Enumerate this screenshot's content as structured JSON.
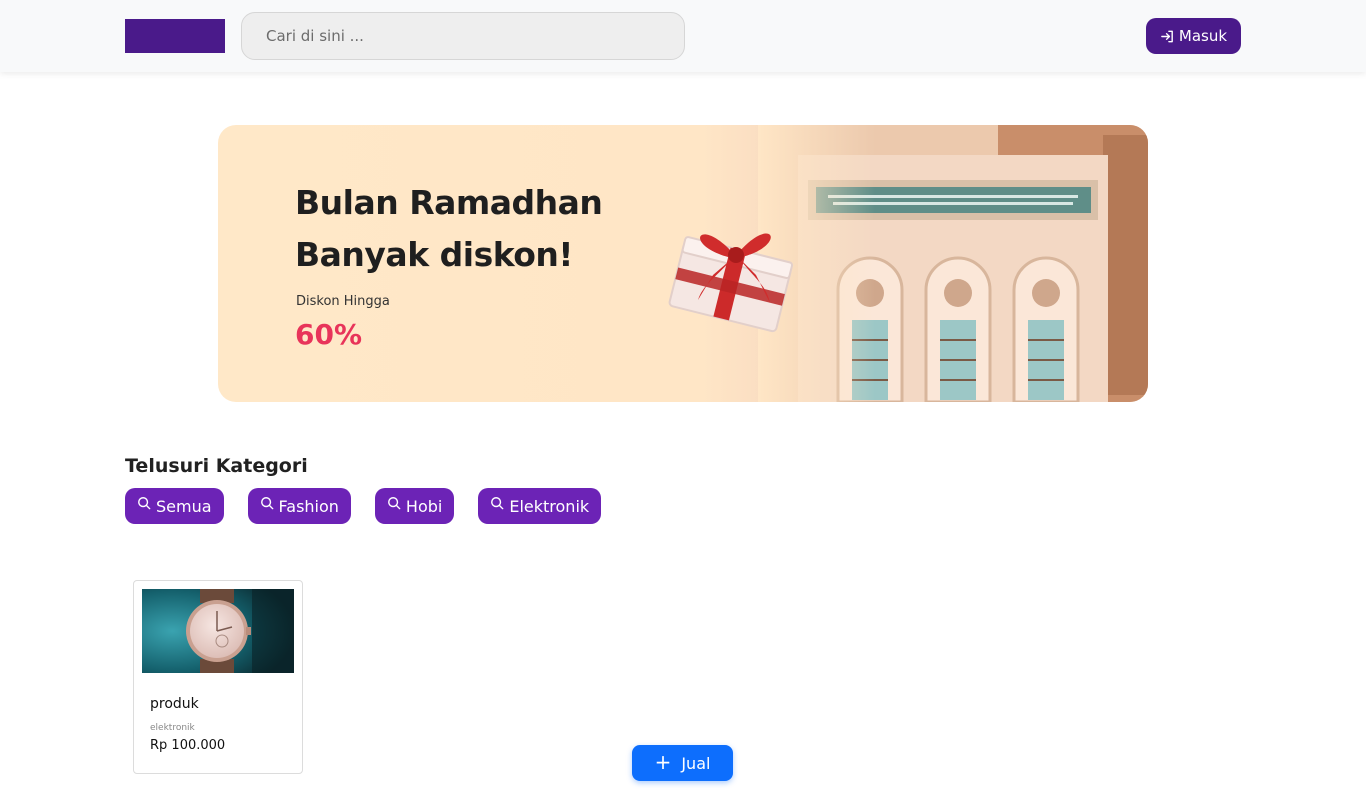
{
  "header": {
    "search_placeholder": "Cari di sini ...",
    "login_label": "Masuk",
    "brand_color": "#4a1a8a"
  },
  "banner": {
    "title_line1": "Bulan Ramadhan",
    "title_line2": "Banyak diskon!",
    "subtitle": "Diskon Hingga",
    "percent": "60%",
    "accent_color": "#e8345a"
  },
  "categories": {
    "title": "Telusuri Kategori",
    "items": [
      {
        "label": "Semua"
      },
      {
        "label": "Fashion"
      },
      {
        "label": "Hobi"
      },
      {
        "label": "Elektronik"
      }
    ],
    "button_color": "#6c23b6"
  },
  "products": [
    {
      "name": "produk",
      "category": "elektronik",
      "price": "Rp 100.000"
    }
  ],
  "sell_button": {
    "label": "Jual",
    "color": "#0d6efd"
  }
}
